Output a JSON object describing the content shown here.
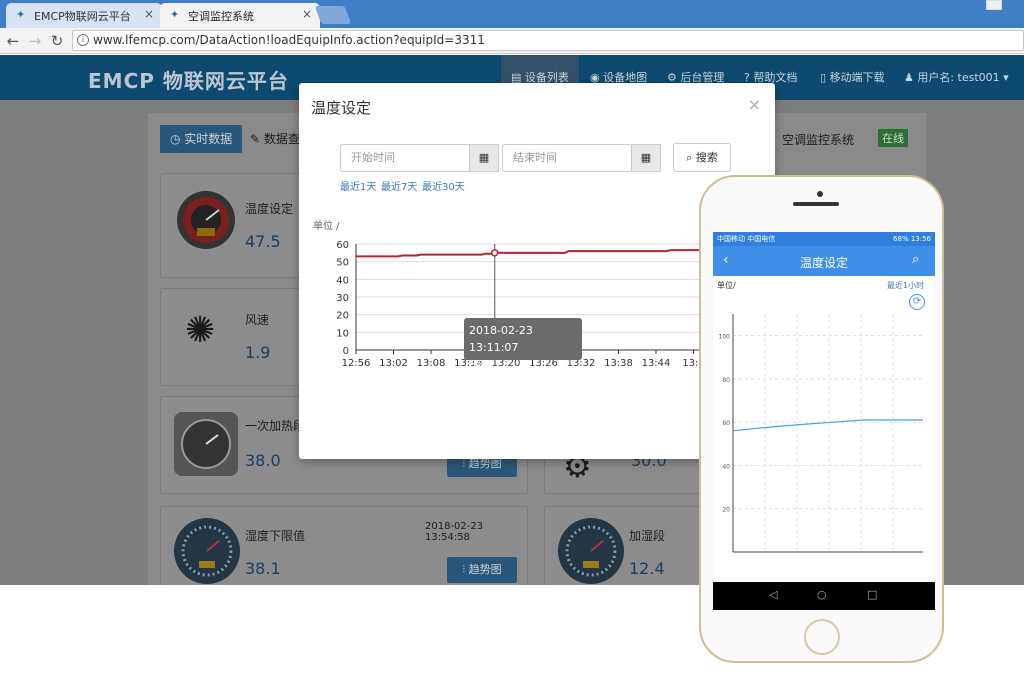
{
  "browser": {
    "tabs": [
      {
        "title": "EMCP物联网云平台",
        "close": "×"
      },
      {
        "title": "空调监控系统",
        "close": "×"
      }
    ],
    "url": "www.lfemcp.com/DataAction!loadEquipInfo.action?equipId=3311"
  },
  "site": {
    "logo": "EMCP 物联网云平台",
    "nav": [
      "设备列表",
      "设备地图",
      "后台管理",
      "帮助文档",
      "移动端下载",
      "用户名: test001 ▾"
    ]
  },
  "content": {
    "tabs": [
      "实时数据",
      "数据查"
    ],
    "system_name": "空调监控系统",
    "status": "在线",
    "status_color": "#2e8b3a",
    "cards": [
      {
        "label": "温度设定",
        "value": "47.5",
        "icon": "gauge-red-icon"
      },
      {
        "label": "风速",
        "value": "1.9",
        "icon": "fan-icon"
      },
      {
        "label": "一次加热段",
        "value": "38.0",
        "icon": "speedometer-icon"
      },
      {
        "label": "",
        "value": "30.0",
        "icon": "gear-icon"
      },
      {
        "label": "湿度下限值",
        "value": "38.1",
        "icon": "dial-icon",
        "time": "2018-02-23 13:54:58"
      },
      {
        "label": "加湿段",
        "value": "12.4",
        "icon": "dial-icon"
      }
    ],
    "trend_label": "趋势图"
  },
  "modal": {
    "title": "温度设定",
    "close": "×",
    "start_placeholder": "开始时间",
    "end_placeholder": "结束时间",
    "search_label": "搜索",
    "quick_ranges": [
      "最近1天",
      "最近7天",
      "最近30天"
    ],
    "tooltip": {
      "time": "2018-02-23 13:11:07",
      "value": "55"
    }
  },
  "chart_data": {
    "type": "line",
    "ylabel": "单位 /",
    "x_ticks": [
      "12:56",
      "13:02",
      "13:08",
      "13:14",
      "13:20",
      "13:26",
      "13:32",
      "13:38",
      "13:44",
      "13:5"
    ],
    "y_ticks": [
      0,
      10,
      20,
      30,
      40,
      50,
      60
    ],
    "ylim": [
      0,
      60
    ],
    "series": [
      {
        "color": "#b5262c",
        "points": [
          [
            "12:56",
            53
          ],
          [
            "13:01",
            53.5
          ],
          [
            "13:03",
            54
          ],
          [
            "13:10",
            54.5
          ],
          [
            "13:11",
            55
          ],
          [
            "13:19",
            56
          ],
          [
            "13:30",
            56.5
          ],
          [
            "13:39",
            57.5
          ],
          [
            "13:50",
            57.8
          ]
        ]
      }
    ]
  },
  "phone": {
    "status_left": "中国移动 中国电信",
    "status_right": "68% 13:56",
    "title": "温度设定",
    "unit": "单位/",
    "range": "最近1小时",
    "y_ticks": [
      20,
      40,
      60,
      80,
      100
    ],
    "nav_back": "◁",
    "nav_home": "○",
    "nav_recent": "□"
  }
}
